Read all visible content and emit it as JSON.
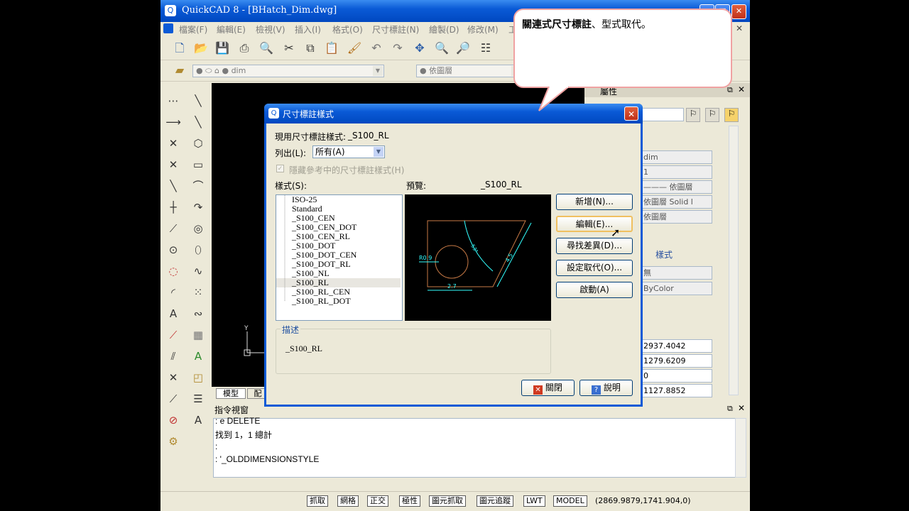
{
  "app": {
    "title": "QuickCAD 8 - [BHatch_Dim.dwg]",
    "menu": [
      "檔案(F)",
      "編輯(E)",
      "檢視(V)",
      "插入(I)",
      "格式(O)",
      "尺寸標註(N)",
      "繪製(D)",
      "修改(M)",
      "工"
    ],
    "layer_combo": "dim",
    "color_combo": "依圖層",
    "tabs": [
      "模型",
      "配"
    ],
    "command": {
      "title": "指令視窗",
      "lines": [
        ": e DELETE",
        "找到 1，1 總計",
        ":",
        ": '_OLDDIMENSIONSTYLE"
      ]
    },
    "status_buttons": [
      "抓取",
      "網格",
      "正交",
      "極性",
      "圖元抓取",
      "圖元追蹤",
      "LWT",
      "MODEL"
    ],
    "coords": "(2869.9879,1741.904,0)"
  },
  "props": {
    "title": "屬性",
    "rows": [
      "dim",
      "1",
      "——— 依圖層",
      "依圖層  Solid l",
      "依圖層"
    ],
    "section": "樣式",
    "rows2": [
      "無",
      "ByColor"
    ],
    "coords": [
      "2937.4042",
      "1279.6209",
      "0",
      "1127.8852"
    ]
  },
  "dialog": {
    "title": "尺寸標註樣式",
    "current_label": "現用尺寸標註樣式:",
    "current_value": "_S100_RL",
    "list_label": "列出(L):",
    "list_value": "所有(A)",
    "hide_label": "隱藏參考中的尺寸標註樣式(H)",
    "styles_label": "樣式(S):",
    "preview_label": "預覽:",
    "preview_name": "_S100_RL",
    "styles": [
      "ISO-25",
      "Standard",
      "_S100_CEN",
      "_S100_CEN_DOT",
      "_S100_CEN_RL",
      "_S100_DOT",
      "_S100_DOT_CEN",
      "_S100_DOT_RL",
      "_S100_NL",
      "_S100_RL",
      "_S100_RL_CEN",
      "_S100_RL_DOT"
    ],
    "selected_index": 9,
    "buttons": {
      "new": "新增(N)...",
      "edit": "編輯(E)...",
      "compare": "尋找差異(D)...",
      "override": "設定取代(O)...",
      "activate": "啟動(A)"
    },
    "desc_label": "描述",
    "desc_value": "_S100_RL",
    "close": "關閉",
    "help": "說明",
    "preview_dims": [
      "R0.9",
      "2.7",
      "4.5",
      "53°"
    ]
  },
  "callout": {
    "bold": "關連式尺寸標註",
    "rest": "、型式取代。"
  },
  "colors": {
    "accent": "#0a5ad6",
    "dim_line": "#33ffff",
    "geometry": "#c87a46"
  }
}
